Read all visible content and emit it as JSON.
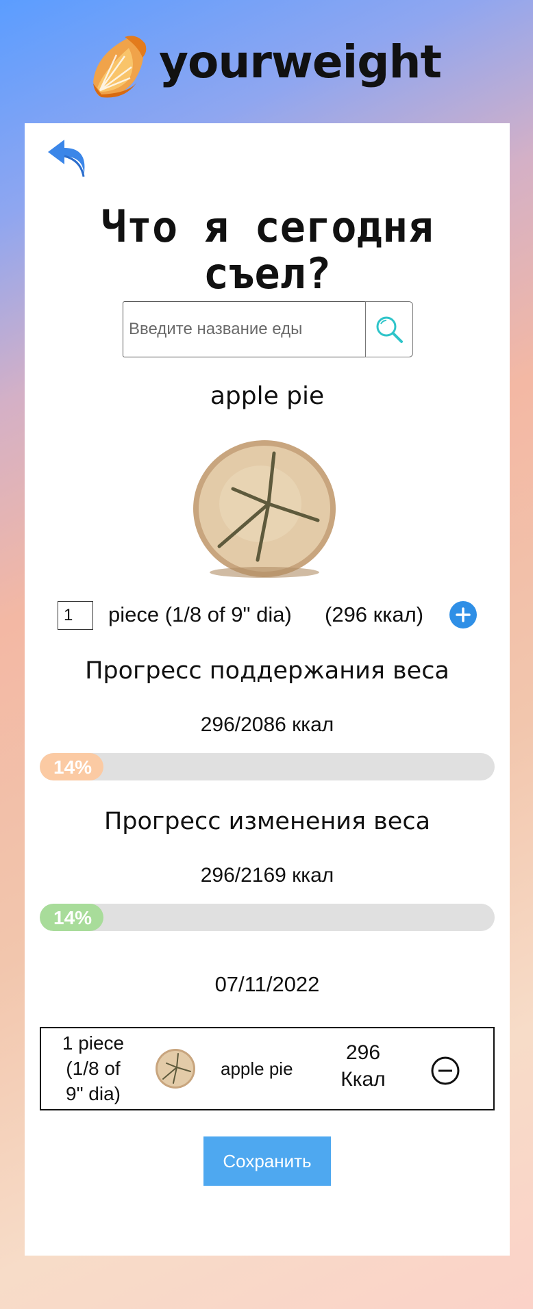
{
  "header": {
    "brand": "yourweight",
    "logo_icon": "orange-slice-icon"
  },
  "nav": {
    "back_icon": "back-arrow-icon"
  },
  "page_title": "Что я сегодня съел?",
  "search": {
    "placeholder": "Введите название еды",
    "value": "",
    "icon": "search-icon"
  },
  "food": {
    "name": "apple pie",
    "image": "apple-pie-image",
    "quantity": "1",
    "portion": "piece (1/8 of 9\" dia)",
    "kcal": "(296 ккал)",
    "add_icon": "plus-circle-icon"
  },
  "maintenance": {
    "title": "Прогресс поддержания веса",
    "summary": "296/2086 ккал",
    "percent_label": "14%",
    "fraction": 0.14,
    "color": "#fbcaa3"
  },
  "change": {
    "title": "Прогресс изменения веса",
    "summary": "296/2169 ккал",
    "percent_label": "14%",
    "fraction": 0.14,
    "color": "#a8dc9a"
  },
  "date": "07/11/2022",
  "entries": [
    {
      "portion_line1": "1  piece",
      "portion_line2": "(1/8 of",
      "portion_line3": "9\" dia)",
      "name": "apple pie",
      "kcal_value": "296",
      "kcal_unit": "Ккал",
      "remove_icon": "minus-circle-icon"
    }
  ],
  "save_label": "Сохранить",
  "colors": {
    "accent_blue": "#2f8fe6",
    "save_button": "#4ea8f0",
    "logo_orange": "#f49a2c"
  }
}
